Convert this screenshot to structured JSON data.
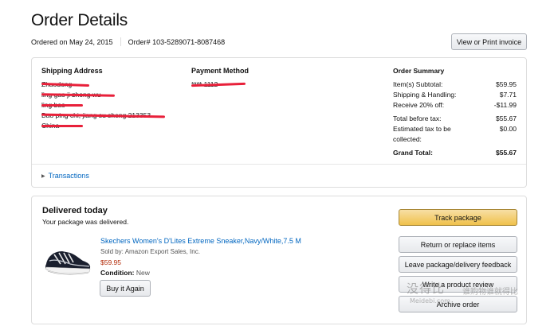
{
  "header": {
    "title": "Order Details",
    "ordered_on": "Ordered on May 24, 2015",
    "order_number": "Order# 103-5289071-8087468",
    "invoice_button": "View or Print invoice"
  },
  "shipping": {
    "heading": "Shipping Address",
    "lines": [
      "Zhaodong",
      "ling gao ji zhong wu",
      "ling bao",
      "Bao ping chi, jiang su sheng 213353",
      "China"
    ]
  },
  "payment": {
    "heading": "Payment Method",
    "line": "**** 1112"
  },
  "summary": {
    "heading": "Order Summary",
    "rows": [
      {
        "label": "Item(s) Subtotal:",
        "value": "$59.95"
      },
      {
        "label": "Shipping & Handling:",
        "value": "$7.71"
      },
      {
        "label": "Receive 20% off:",
        "value": "-$11.99"
      },
      {
        "label": "Total before tax:",
        "value": "$55.67"
      },
      {
        "label": "Estimated tax to be collected:",
        "value": "$0.00"
      },
      {
        "label": "Grand Total:",
        "value": "$55.67"
      }
    ]
  },
  "transactions": {
    "label": "Transactions"
  },
  "delivery": {
    "title": "Delivered today",
    "subtitle": "Your package was delivered.",
    "product": {
      "title": "Skechers Women's D'Lites Extreme Sneaker,Navy/White,7.5 M",
      "seller": "Sold by: Amazon Export Sales, Inc.",
      "price": "$59.95",
      "condition_label": "Condition:",
      "condition_value": "New",
      "buy_again": "Buy it Again"
    },
    "actions": {
      "track": "Track package",
      "return": "Return or replace items",
      "feedback": "Leave package/delivery feedback",
      "review": "Write a product review",
      "archive": "Archive order"
    }
  },
  "watermark": {
    "brand": "没得比",
    "tag": "谁购物谁就得比",
    "url": "Meidebi.com"
  },
  "colors": {
    "link": "#0066c0",
    "price": "#b12704",
    "track_button": "#f0c14b",
    "redaction": "#e8203a"
  }
}
